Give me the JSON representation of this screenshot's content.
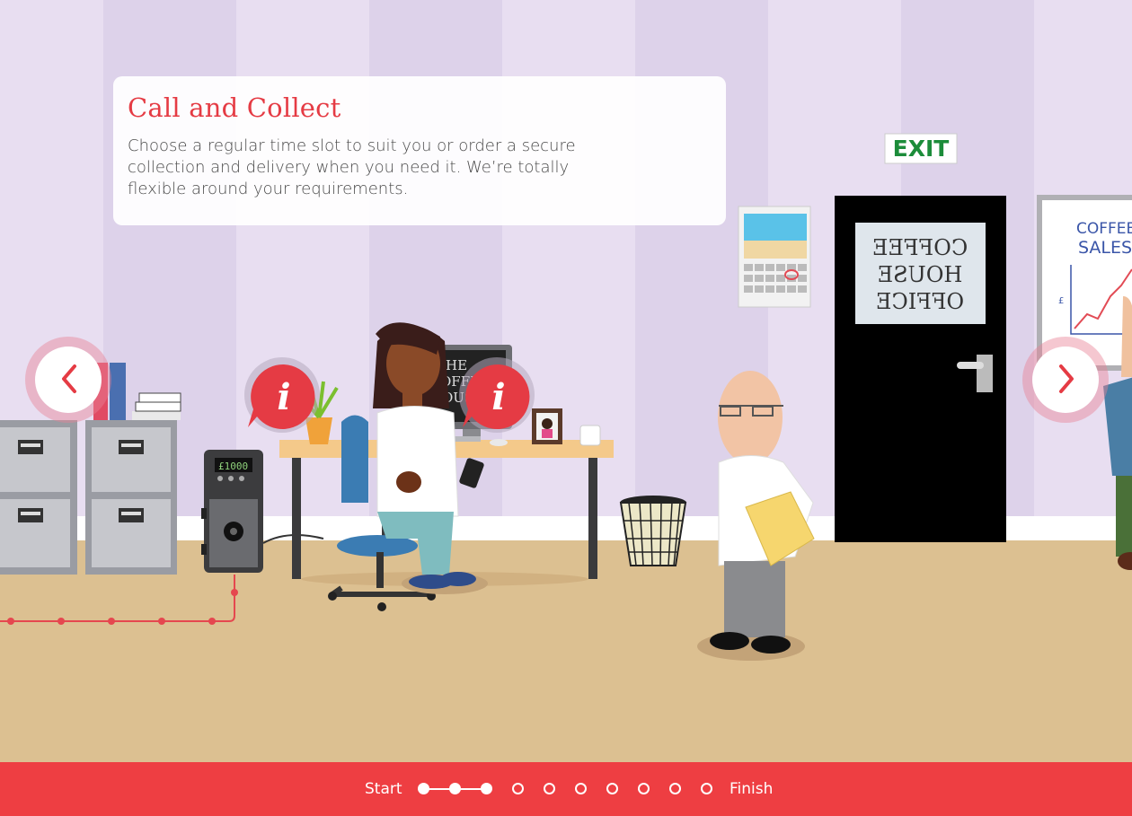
{
  "info": {
    "title": "Call and Collect",
    "body": "Choose a regular time slot to suit you or order a secure collection and delivery when you need it. We’re totally flexible around your requirements."
  },
  "scene": {
    "exit_sign": "EXIT",
    "door_sign": [
      "COFFEE",
      "HOUSE",
      "OFFICE"
    ],
    "whiteboard_lines": [
      "COFFEE",
      "SALES"
    ],
    "whiteboard_axis_label": "£",
    "safe_display": "£1000",
    "monitor_text": [
      "HE",
      "OFFE",
      "OUS"
    ]
  },
  "navigation": {
    "prev_icon": "chevron-left-icon",
    "next_icon": "chevron-right-icon",
    "info_icon": "info-icon"
  },
  "progress": {
    "start_label": "Start",
    "finish_label": "Finish",
    "total_steps": 10,
    "completed_steps": 3
  },
  "colors": {
    "accent": "#ee3e42",
    "title_red": "#e53b44",
    "wall": "#e8def1",
    "floor": "#dcc091"
  }
}
